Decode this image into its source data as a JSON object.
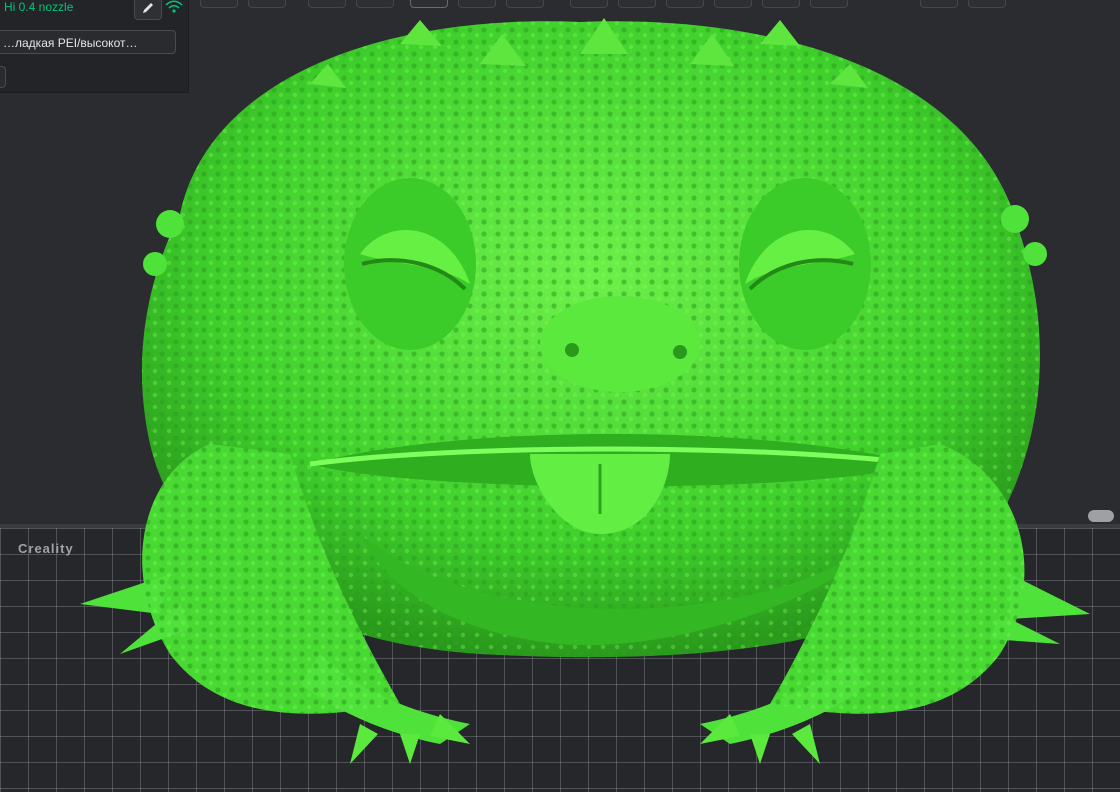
{
  "printer": {
    "name": "Hi 0.4 nozzle",
    "name_color": "#00c47a"
  },
  "plate": {
    "selected": "…ладкая PEI/высокот…"
  },
  "bed": {
    "logo_text": "Creality"
  },
  "model": {
    "color": "#4fe23a",
    "shade": "#2fa21f",
    "highlight": "#7dff5c"
  },
  "icons": {
    "edit": "pencil-icon",
    "wifi": "wifi-icon"
  },
  "toolbar": {
    "button_count": 15
  }
}
